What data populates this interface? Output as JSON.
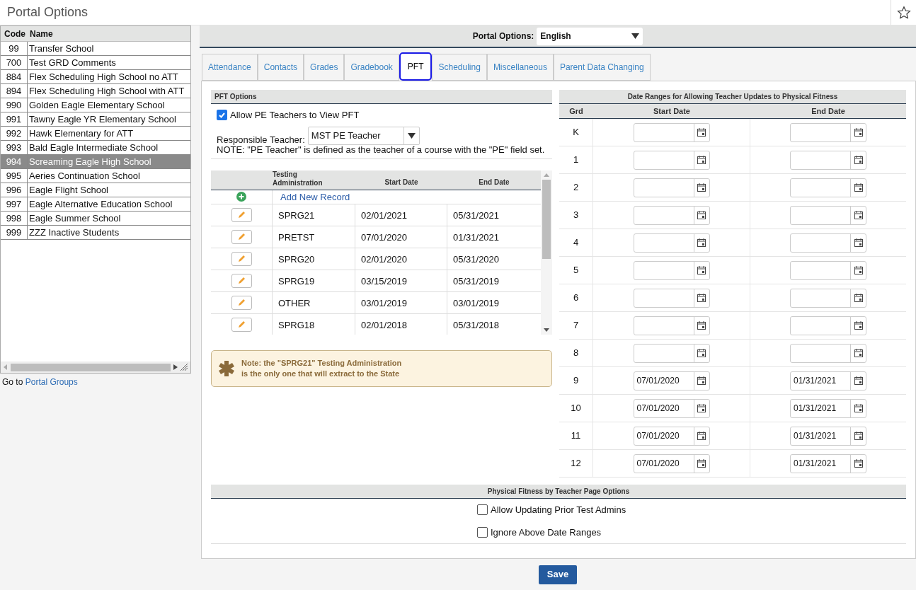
{
  "page_title": "Portal Options",
  "school_list": {
    "columns": [
      "Code",
      "Name"
    ],
    "rows": [
      {
        "code": "99",
        "name": "Transfer School",
        "selected": false
      },
      {
        "code": "700",
        "name": "Test GRD Comments",
        "selected": false
      },
      {
        "code": "884",
        "name": "Flex Scheduling High School no ATT",
        "selected": false
      },
      {
        "code": "894",
        "name": "Flex Scheduling High School with ATT",
        "selected": false
      },
      {
        "code": "990",
        "name": "Golden Eagle Elementary School",
        "selected": false
      },
      {
        "code": "991",
        "name": "Tawny Eagle YR Elementary School",
        "selected": false
      },
      {
        "code": "992",
        "name": "Hawk Elementary for ATT",
        "selected": false
      },
      {
        "code": "993",
        "name": "Bald Eagle Intermediate School",
        "selected": false
      },
      {
        "code": "994",
        "name": "Screaming Eagle High School",
        "selected": true
      },
      {
        "code": "995",
        "name": "Aeries Continuation School",
        "selected": false
      },
      {
        "code": "996",
        "name": "Eagle Flight School",
        "selected": false
      },
      {
        "code": "997",
        "name": "Eagle Alternative Education School",
        "selected": false
      },
      {
        "code": "998",
        "name": "Eagle Summer School",
        "selected": false
      },
      {
        "code": "999",
        "name": "ZZZ Inactive Students",
        "selected": false
      }
    ]
  },
  "footer": {
    "prefix": "Go to",
    "link": "Portal Groups"
  },
  "portal_options": {
    "label": "Portal Options:",
    "value": "English"
  },
  "tabs": [
    {
      "label": "Attendance",
      "selected": false
    },
    {
      "label": "Contacts",
      "selected": false
    },
    {
      "label": "Grades",
      "selected": false
    },
    {
      "label": "Gradebook",
      "selected": false
    },
    {
      "label": "PFT",
      "selected": true
    },
    {
      "label": "Scheduling",
      "selected": false
    },
    {
      "label": "Miscellaneous",
      "selected": false
    },
    {
      "label": "Parent Data Changing",
      "selected": false
    }
  ],
  "pft_options": {
    "header": "PFT Options",
    "allow": {
      "label": "Allow PE Teachers to View PFT",
      "checked": true
    },
    "teacher_label": "Responsible Teacher:",
    "teacher_value": "MST PE Teacher",
    "note": "NOTE: \"PE Teacher\" is defined as the teacher of a course with the \"PE\" field set."
  },
  "admin_table": {
    "columns": [
      "Testing Administration",
      "Start Date",
      "End Date"
    ],
    "add_label": "Add New Record",
    "rows": [
      {
        "code": "SPRG21",
        "start": "02/01/2021",
        "end": "05/31/2021"
      },
      {
        "code": "PRETST",
        "start": "07/01/2020",
        "end": "01/31/2021"
      },
      {
        "code": "SPRG20",
        "start": "02/01/2020",
        "end": "05/31/2020"
      },
      {
        "code": "SPRG19",
        "start": "03/15/2019",
        "end": "05/31/2019"
      },
      {
        "code": "OTHER",
        "start": "03/01/2019",
        "end": "03/01/2019"
      },
      {
        "code": "SPRG18",
        "start": "02/01/2018",
        "end": "05/31/2018"
      }
    ]
  },
  "state_note": {
    "lines": [
      "Note: the \"SPRG21\" Testing Administration",
      "is the only one that will extract to the State"
    ]
  },
  "date_ranges": {
    "title": "Date Ranges for Allowing Teacher Updates to Physical Fitness",
    "columns": [
      "Grd",
      "Start Date",
      "End Date"
    ],
    "rows": [
      {
        "grade": "K"
      },
      {
        "grade": "1"
      },
      {
        "grade": "2"
      },
      {
        "grade": "3"
      },
      {
        "grade": "4"
      },
      {
        "grade": "5"
      },
      {
        "grade": "6"
      },
      {
        "grade": "7"
      },
      {
        "grade": "8"
      },
      {
        "grade": "9",
        "start": "07/01/2020",
        "end": "01/31/2021"
      },
      {
        "grade": "10",
        "start": "07/01/2020",
        "end": "01/31/2021"
      },
      {
        "grade": "11",
        "start": "07/01/2020",
        "end": "01/31/2021"
      },
      {
        "grade": "12",
        "start": "07/01/2020",
        "end": "01/31/2021"
      }
    ]
  },
  "page_options": {
    "title": "Physical Fitness by Teacher Page Options",
    "options": [
      {
        "label": "Allow Updating Prior Test Admins",
        "checked": false
      },
      {
        "label": "Ignore Above Date Ranges",
        "checked": false
      }
    ]
  },
  "save_button": "Save"
}
